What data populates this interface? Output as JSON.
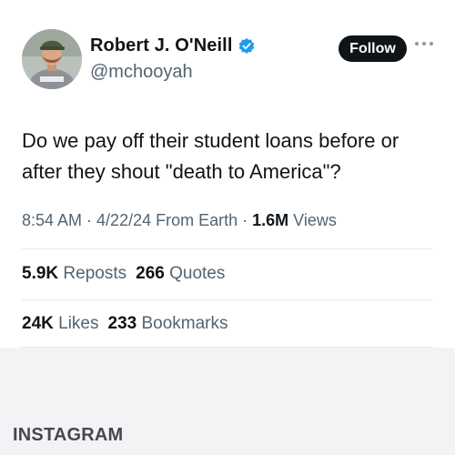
{
  "author": {
    "name": "Robert J. O'Neill",
    "handle": "@mchooyah",
    "avatar_icon": "profile-photo",
    "verified_icon": "verified-badge-icon",
    "verified_color": "#1d9bf0"
  },
  "actions": {
    "follow_label": "Follow",
    "more_icon": "more-options-icon"
  },
  "tweet": {
    "text": "Do we pay off their student loans before or after they shout \"death to America\"?"
  },
  "meta": {
    "time": "8:54 AM",
    "sep1": " · ",
    "date": "4/22/24",
    "source": " From Earth",
    "sep2": " · ",
    "views_count": "1.6M",
    "views_label": " Views"
  },
  "stats": {
    "reposts_count": "5.9K",
    "reposts_label": " Reposts",
    "quotes_count": "266",
    "quotes_label": " Quotes",
    "likes_count": "24K",
    "likes_label": " Likes",
    "bookmarks_count": "233",
    "bookmarks_label": " Bookmarks"
  },
  "footer": {
    "label": "INSTAGRAM"
  }
}
